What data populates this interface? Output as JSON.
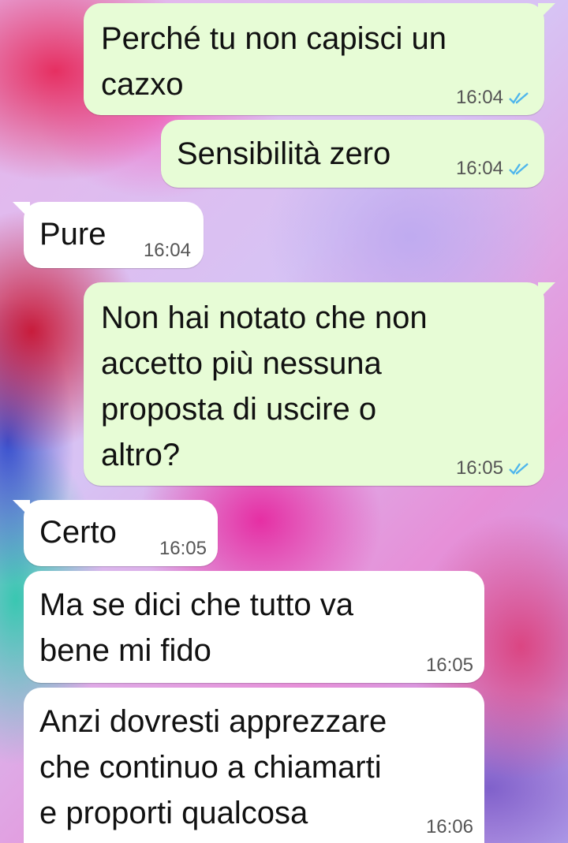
{
  "messages": [
    {
      "text": "Perché tu non capisci un\ncazxo",
      "time": "16:04",
      "direction": "outgoing",
      "status": "read"
    },
    {
      "text": "Sensibilità zero",
      "time": "16:04",
      "direction": "outgoing",
      "status": "read"
    },
    {
      "text": "Pure",
      "time": "16:04",
      "direction": "incoming"
    },
    {
      "text": "Non hai notato che non\naccetto più nessuna\nproposta di uscire o\naltro?",
      "time": "16:05",
      "direction": "outgoing",
      "status": "read"
    },
    {
      "text": "Certo",
      "time": "16:05",
      "direction": "incoming"
    },
    {
      "text": "Ma se dici che tutto va\nbene mi fido",
      "time": "16:05",
      "direction": "incoming"
    },
    {
      "text": "Anzi dovresti apprezzare\nche continuo a chiamarti\ne proporti qualcosa",
      "time": "16:06",
      "direction": "incoming"
    }
  ],
  "colors": {
    "outgoing_bubble": "#e7fcd6",
    "incoming_bubble": "#ffffff",
    "read_ticks": "#4fb6ec"
  },
  "icons": {
    "read_receipt": "double-check-icon"
  }
}
